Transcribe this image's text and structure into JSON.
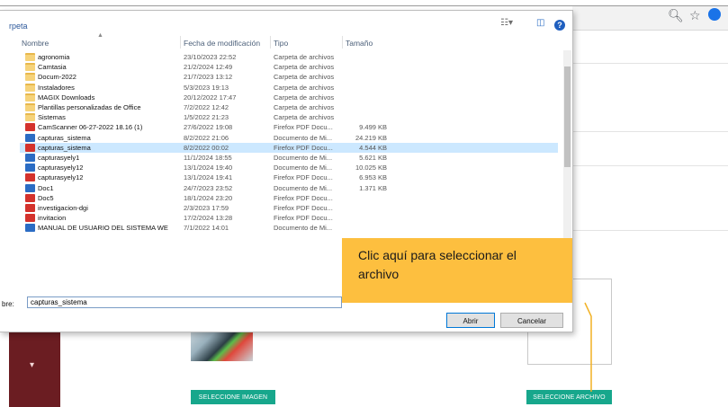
{
  "dialog": {
    "title": "rpeta",
    "columns": {
      "name": "Nombre",
      "date": "Fecha de modificación",
      "type": "Tipo",
      "size": "Tamaño"
    },
    "files": [
      {
        "name": "agronomia",
        "date": "23/10/2023 22:52",
        "type": "Carpeta de archivos",
        "size": "",
        "icon": "folder-icon"
      },
      {
        "name": "Camtasia",
        "date": "21/2/2024 12:49",
        "type": "Carpeta de archivos",
        "size": "",
        "icon": "folder-icon"
      },
      {
        "name": "Docum-2022",
        "date": "21/7/2023 13:12",
        "type": "Carpeta de archivos",
        "size": "",
        "icon": "folder-icon"
      },
      {
        "name": "Instaladores",
        "date": "5/3/2023 19:13",
        "type": "Carpeta de archivos",
        "size": "",
        "icon": "folder-icon"
      },
      {
        "name": "MAGIX Downloads",
        "date": "20/12/2022 17:47",
        "type": "Carpeta de archivos",
        "size": "",
        "icon": "folder-icon"
      },
      {
        "name": "Plantillas personalizadas de Office",
        "date": "7/2/2022 12:42",
        "type": "Carpeta de archivos",
        "size": "",
        "icon": "folder-icon"
      },
      {
        "name": "Sistemas",
        "date": "1/5/2022 21:23",
        "type": "Carpeta de archivos",
        "size": "",
        "icon": "folder-icon"
      },
      {
        "name": "CamScanner 06-27-2022 18.16 (1)",
        "date": "27/6/2022 19:08",
        "type": "Firefox PDF Docu...",
        "size": "9.499 KB",
        "icon": "pdf-file-icon"
      },
      {
        "name": "capturas_sistema",
        "date": "8/2/2022 21:06",
        "type": "Documento de Mi...",
        "size": "24.219 KB",
        "icon": "word-file-icon"
      },
      {
        "name": "capturas_sistema",
        "date": "8/2/2022 00:02",
        "type": "Firefox PDF Docu...",
        "size": "4.544 KB",
        "icon": "pdf-file-icon",
        "selected": true
      },
      {
        "name": "capturasyely1",
        "date": "11/1/2024 18:55",
        "type": "Documento de Mi...",
        "size": "5.621 KB",
        "icon": "word-file-icon"
      },
      {
        "name": "capturasyely12",
        "date": "13/1/2024 19:40",
        "type": "Documento de Mi...",
        "size": "10.025 KB",
        "icon": "word-file-icon"
      },
      {
        "name": "capturasyely12",
        "date": "13/1/2024 19:41",
        "type": "Firefox PDF Docu...",
        "size": "6.953 KB",
        "icon": "pdf-file-icon"
      },
      {
        "name": "Doc1",
        "date": "24/7/2023 23:52",
        "type": "Documento de Mi...",
        "size": "1.371 KB",
        "icon": "word-file-icon"
      },
      {
        "name": "Doc5",
        "date": "18/1/2024 23:20",
        "type": "Firefox PDF Docu...",
        "size": "",
        "icon": "pdf-file-icon"
      },
      {
        "name": "investigacion-dgi",
        "date": "2/3/2023 17:59",
        "type": "Firefox PDF Docu...",
        "size": "",
        "icon": "pdf-file-icon"
      },
      {
        "name": "invitacion",
        "date": "17/2/2024 13:28",
        "type": "Firefox PDF Docu...",
        "size": "",
        "icon": "pdf-file-icon"
      },
      {
        "name": "MANUAL DE USUARIO DEL SISTEMA WE",
        "date": "7/1/2022 14:01",
        "type": "Documento de Mi...",
        "size": "",
        "icon": "word-file-icon"
      }
    ],
    "filename_label": "bre:",
    "filename_value": "capturas_sistema",
    "open_button": "Abrir",
    "cancel_button": "Cancelar"
  },
  "callout": {
    "line1": "Clic aquí para seleccionar el",
    "line2": "archivo"
  },
  "page": {
    "select_image_button": "SELECCIONE IMAGEN",
    "select_file_button": "SELECCIONE ARCHIVO"
  },
  "colors": {
    "callout": "#fdbf3f",
    "teal_button": "#17a78c",
    "sidebar": "#6b1d22",
    "selection": "#cce8ff"
  }
}
